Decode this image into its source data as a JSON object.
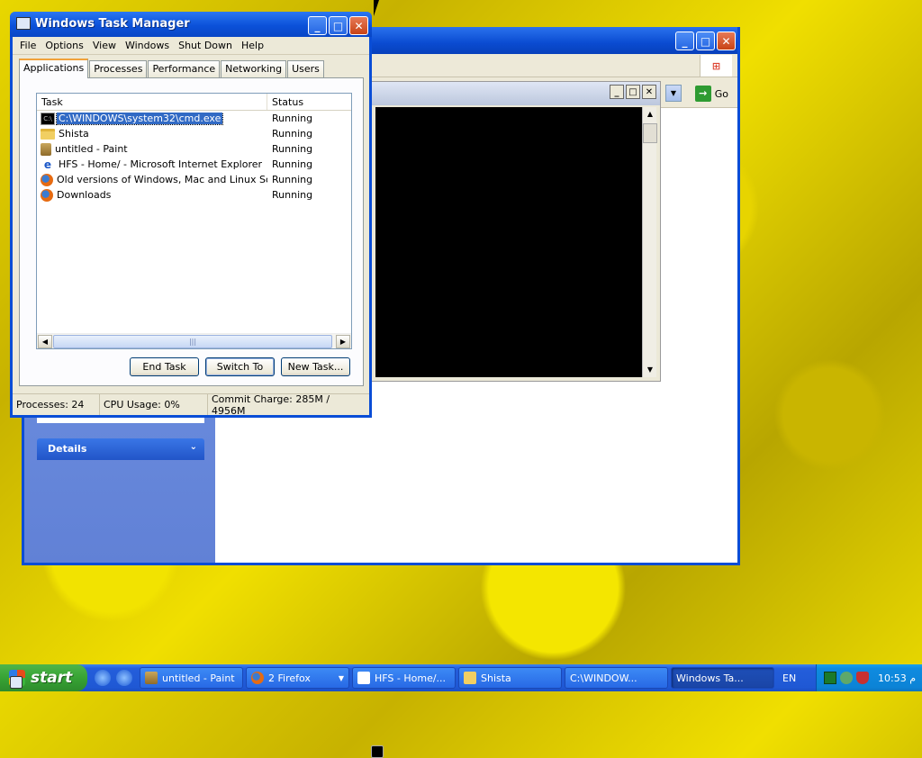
{
  "taskmanager": {
    "title": "Windows Task Manager",
    "menu": [
      "File",
      "Options",
      "View",
      "Windows",
      "Shut Down",
      "Help"
    ],
    "tabs": [
      "Applications",
      "Processes",
      "Performance",
      "Networking",
      "Users"
    ],
    "active_tab": "Applications",
    "columns": {
      "task": "Task",
      "status": "Status"
    },
    "rows": [
      {
        "task": "C:\\WINDOWS\\system32\\cmd.exe",
        "status": "Running",
        "icon": "cmd-icon"
      },
      {
        "task": "Shista",
        "status": "Running",
        "icon": "folder-icon"
      },
      {
        "task": "untitled - Paint",
        "status": "Running",
        "icon": "paint-icon"
      },
      {
        "task": "HFS - Home/ - Microsoft Internet Explorer",
        "status": "Running",
        "icon": "ie-icon"
      },
      {
        "task": "Old versions of Windows, Mac and Linux Soft...",
        "status": "Running",
        "icon": "firefox-icon"
      },
      {
        "task": "Downloads",
        "status": "Running",
        "icon": "firefox-icon"
      }
    ],
    "buttons": {
      "end_task": "End Task",
      "switch_to": "Switch To",
      "new_task": "New Task..."
    },
    "status": {
      "processes": "Processes: 24",
      "cpu": "CPU Usage: 0%",
      "commit": "Commit Charge: 285M / 4956M"
    },
    "window_buttons": {
      "minimize": "_",
      "maximize": "□",
      "close": "✕"
    }
  },
  "explorer": {
    "details_label": "Details",
    "go_label": "Go",
    "window_buttons": {
      "minimize": "_",
      "maximize": "□",
      "close": "✕"
    }
  },
  "cmd_window": {
    "window_buttons": {
      "minimize": "_",
      "maximize": "□",
      "close": "✕"
    }
  },
  "taskbar": {
    "start_label": "start",
    "items": [
      {
        "label": "untitled - Paint",
        "icon": "paint-icon",
        "active": false
      },
      {
        "label": "2 Firefox",
        "icon": "firefox-icon",
        "active": false,
        "group": true
      },
      {
        "label": "HFS - Home/...",
        "icon": "ie-icon",
        "active": false
      },
      {
        "label": "Shista",
        "icon": "folder-icon",
        "active": false
      },
      {
        "label": "C:\\WINDOW...",
        "icon": "cmd-icon",
        "active": false
      },
      {
        "label": "Windows Ta...",
        "icon": "taskmanager-icon",
        "active": true
      }
    ],
    "language": "EN",
    "clock": "10:53 م"
  },
  "colors": {
    "xp_blue": "#0a4dd6",
    "selection": "#316ac5",
    "taskbar": "#245edb",
    "start_green": "#37a334"
  }
}
